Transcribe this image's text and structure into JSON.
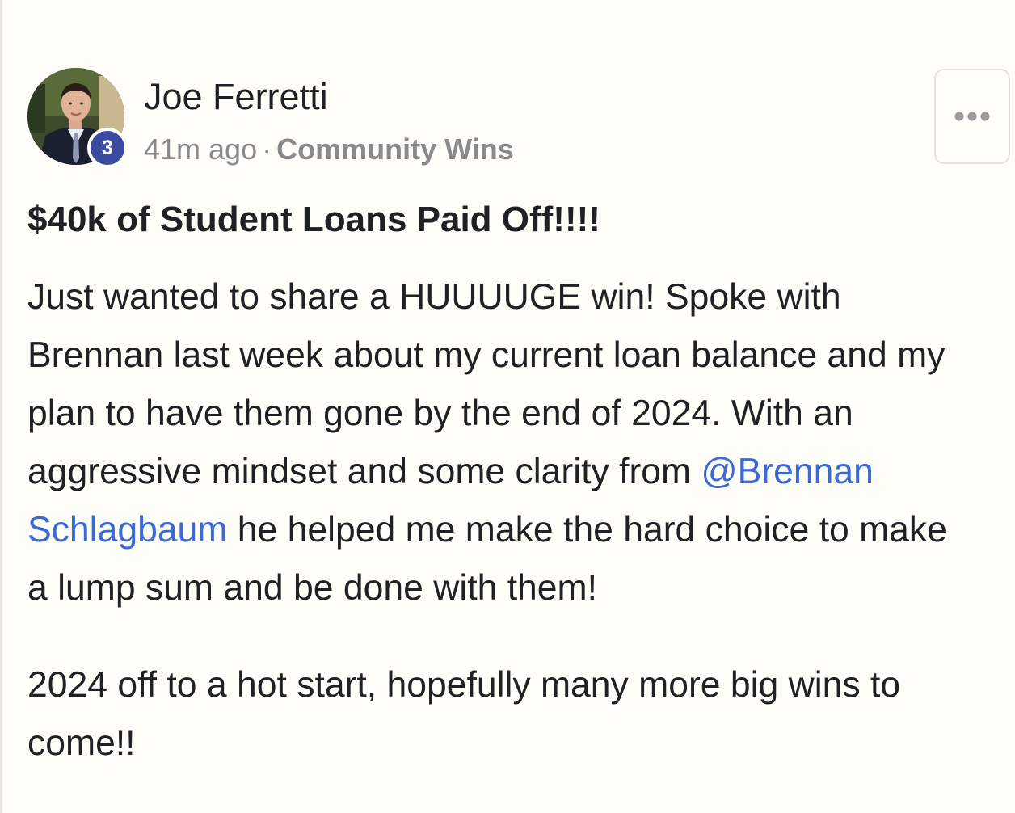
{
  "author": {
    "name": "Joe Ferretti",
    "level": "3"
  },
  "meta": {
    "time": "41m ago",
    "separator": "·",
    "category": "Community Wins"
  },
  "menu": {
    "icon": "more-horizontal-icon"
  },
  "post": {
    "title": "$40k of Student Loans Paid Off!!!!",
    "paragraph1": {
      "line1": "Just wanted to share a HUUUUGE win! Spoke with",
      "line2": "Brennan last week about my current loan balance and my",
      "line3": "plan to have them gone by the end of 2024. With an",
      "line4_before": "aggressive mindset and some clarity from ",
      "mention_part1": "@Brennan",
      "mention_part2": "Schlagbaum",
      "line5_after": " he helped me make the hard choice to make",
      "line6": "a lump sum and be done with them!"
    },
    "paragraph2": {
      "line1": "2024 off to a hot start, hopefully many more big wins to",
      "line2": "come!!"
    }
  },
  "colors": {
    "background": "#fefdf8",
    "text": "#202124",
    "muted": "#8a8a8a",
    "mention": "#3a6ad6",
    "badge": "#3b4ca0"
  }
}
